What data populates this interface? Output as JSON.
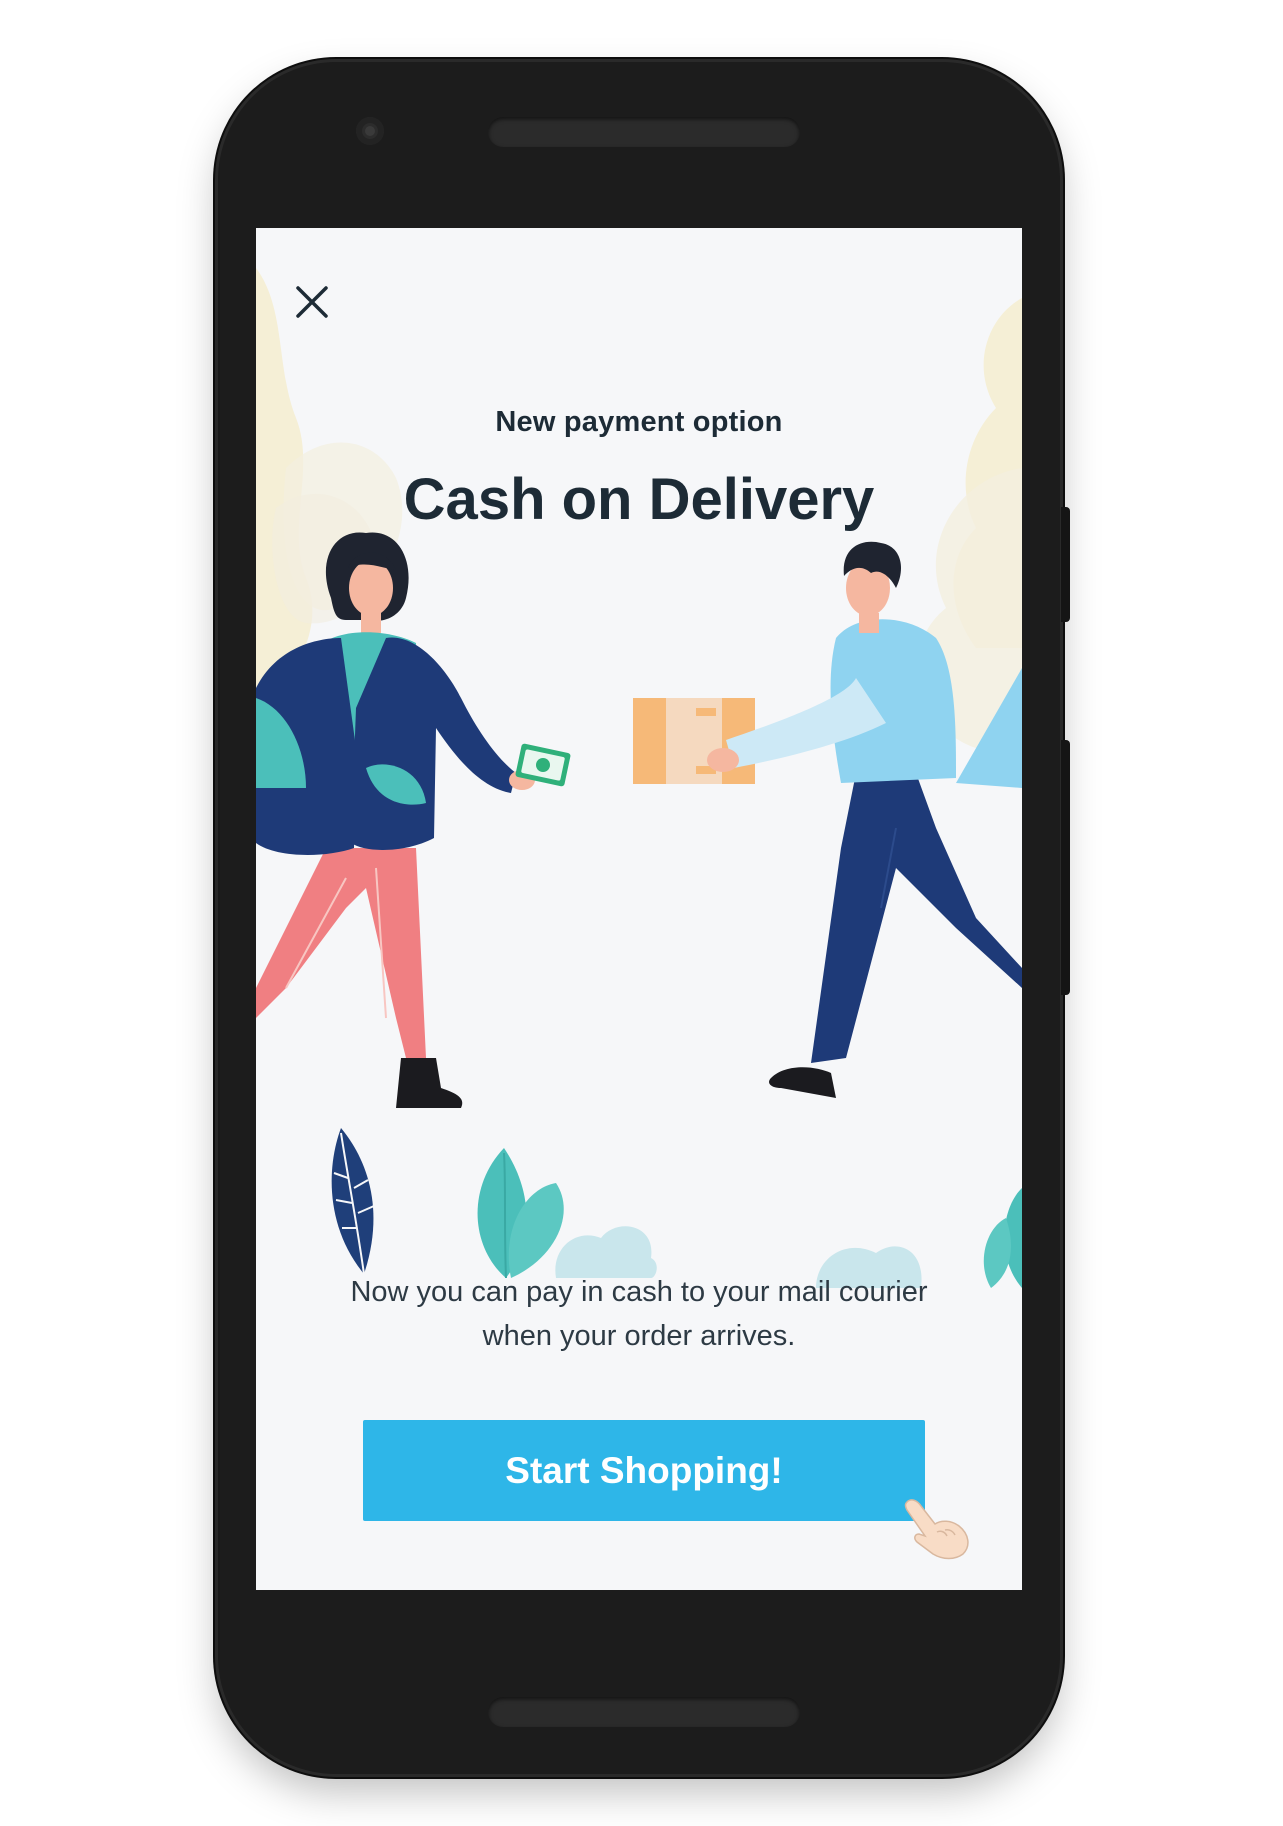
{
  "modal": {
    "close_icon": "close-icon",
    "subtitle": "New payment option",
    "title": "Cash on Delivery",
    "description": "Now you can pay in cash to your mail courier when your order arrives.",
    "cta_label": "Start Shopping!"
  },
  "colors": {
    "accent": "#2eb6e8",
    "title_text": "#1d2b36",
    "screen_background": "#f6f7f9",
    "blob": "#f5efd6"
  }
}
